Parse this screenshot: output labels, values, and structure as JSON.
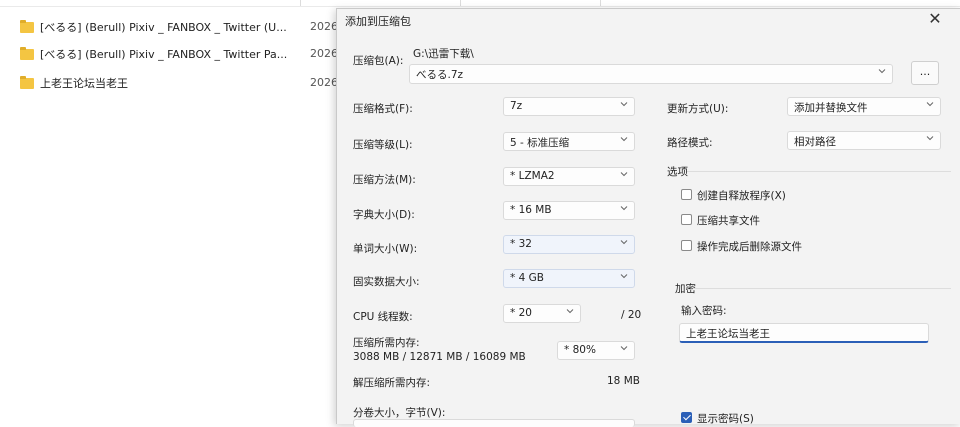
{
  "explorer": {
    "rows": [
      {
        "name": "[べるる] (Berull) Pixiv _ FANBOX _ Twitter (U...",
        "date": "2026/"
      },
      {
        "name": "[べるる] (Berull) Pixiv _ FANBOX _ Twitter Pa...",
        "date": "2026/"
      },
      {
        "name": "上老王论坛当老王",
        "date": "2026/"
      }
    ]
  },
  "dialog": {
    "title": "添加到压缩包",
    "close_icon": "close-icon",
    "archive_label": "压缩包(A):",
    "archive_dir": "G:\\迅雷下载\\",
    "archive_name": "べるる.7z",
    "browse_label": "...",
    "format_label": "压缩格式(F):",
    "format_value": "7z",
    "level_label": "压缩等级(L):",
    "level_value": "5 - 标准压缩",
    "method_label": "压缩方法(M):",
    "method_value": "* LZMA2",
    "dict_label": "字典大小(D):",
    "dict_value": "* 16 MB",
    "word_label": "单词大小(W):",
    "word_value": "* 32",
    "solid_label": "固实数据大小:",
    "solid_value": "* 4 GB",
    "threads_label": "CPU 线程数:",
    "threads_value": "* 20",
    "threads_total": "/ 20",
    "mem_label": "压缩所需内存:",
    "mem_detail": "3088 MB / 12871 MB / 16089 MB",
    "mem_value": "* 80%",
    "decomp_label": "解压缩所需内存:",
    "decomp_value": "18 MB",
    "volume_label": "分卷大小，字节(V):",
    "update_label": "更新方式(U):",
    "update_value": "添加并替换文件",
    "path_label": "路径模式:",
    "path_value": "相对路径",
    "options_title": "选项",
    "opt_sfx": "创建自释放程序(X)",
    "opt_shared": "压缩共享文件",
    "opt_delete": "操作完成后删除源文件",
    "enc_title": "加密",
    "pwd_label": "输入密码:",
    "pwd_value": "上老王论坛当老王",
    "show_pwd": "显示密码(S)"
  },
  "colors": {
    "accent": "#2b5fb7",
    "folder": "#f4c542",
    "dialog_bg": "#f3f3f3"
  }
}
